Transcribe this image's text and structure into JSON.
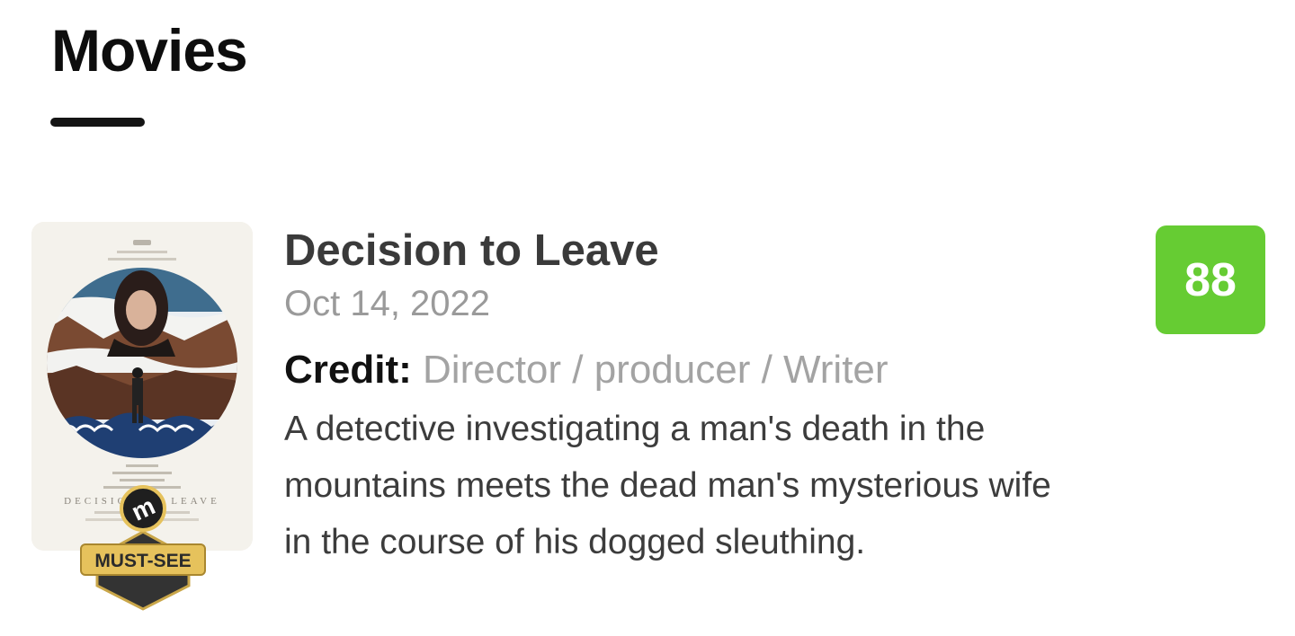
{
  "section": {
    "title": "Movies"
  },
  "movie": {
    "title": "Decision to Leave",
    "release_date": "Oct 14, 2022",
    "credit_label": "Credit:",
    "credit_value": "Director / producer / Writer",
    "description": "A detective investigating a man's death in the mountains meets the dead man's mysterious wife in the course of his dogged sleuthing.",
    "score": "88",
    "score_color": "#66cc33",
    "poster": {
      "title_text": "DECISION TO LEAVE",
      "badge_text": "MUST-SEE",
      "badge_logo": "m",
      "badge_icon": "must-see-badge-icon"
    }
  }
}
